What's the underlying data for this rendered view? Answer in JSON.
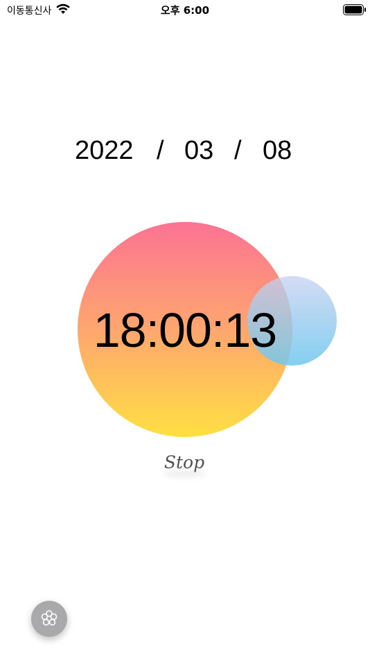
{
  "status_bar": {
    "carrier": "이동통신사",
    "time": "오후 6:00",
    "wifi_icon": "wifi-icon",
    "battery_icon": "battery-icon"
  },
  "date": {
    "year": "2022",
    "separator": "/",
    "month": "03",
    "day": "08"
  },
  "clock": {
    "time": "18:00:13"
  },
  "controls": {
    "stop_label": "Stop",
    "menu_icon": "flower-icon"
  },
  "colors": {
    "circle_top": "#fb7393",
    "circle_bottom": "#ffdf43",
    "small_circle_top": "#c6d0f0",
    "small_circle_bottom": "#6ec6ee",
    "menu_button": "#a9a9ab",
    "stop_text": "#505050"
  }
}
